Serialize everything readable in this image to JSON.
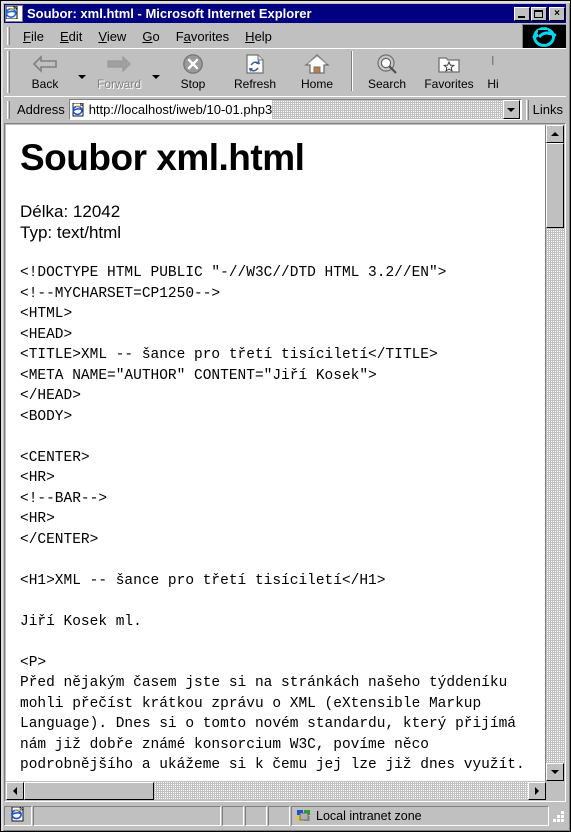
{
  "window": {
    "title": "Soubor: xml.html - Microsoft Internet Explorer",
    "icon": "ie-document-icon",
    "minimize_label": "",
    "maximize_label": "",
    "close_label": "×",
    "titlebar_color": "#000080",
    "face_color": "#c0c0c0"
  },
  "menu": {
    "items": [
      {
        "label": "File",
        "accel": "F"
      },
      {
        "label": "Edit",
        "accel": "E"
      },
      {
        "label": "View",
        "accel": "V"
      },
      {
        "label": "Go",
        "accel": "G"
      },
      {
        "label": "Favorites",
        "accel": "a"
      },
      {
        "label": "Help",
        "accel": "H"
      }
    ],
    "brand_icon": "ie-logo-icon"
  },
  "toolbar": {
    "buttons": [
      {
        "label": "Back",
        "icon": "back-arrow-icon",
        "disabled": false,
        "has_dropdown": true
      },
      {
        "label": "Forward",
        "icon": "forward-arrow-icon",
        "disabled": true,
        "has_dropdown": true
      },
      {
        "label": "Stop",
        "icon": "stop-icon",
        "disabled": false,
        "has_dropdown": false
      },
      {
        "label": "Refresh",
        "icon": "refresh-icon",
        "disabled": false,
        "has_dropdown": false
      },
      {
        "label": "Home",
        "icon": "home-icon",
        "disabled": false,
        "has_dropdown": false
      },
      {
        "label": "Search",
        "icon": "search-icon",
        "disabled": false,
        "has_dropdown": false
      },
      {
        "label": "Favorites",
        "icon": "favorites-icon",
        "disabled": false,
        "has_dropdown": false
      },
      {
        "label": "Hi",
        "icon": "history-icon",
        "disabled": false,
        "has_dropdown": false
      }
    ]
  },
  "address": {
    "label": "Address",
    "value": "http://localhost/iweb/10-01.php3",
    "placeholder": "",
    "icon": "ie-document-icon",
    "dropdown_icon": "chevron-down-icon",
    "links_label": "Links"
  },
  "page": {
    "heading": "Soubor xml.html",
    "meta": [
      "Délka: 12042",
      "Typ: text/html"
    ],
    "source": "<!DOCTYPE HTML PUBLIC \"-//W3C//DTD HTML 3.2//EN\">\n<!--MYCHARSET=CP1250-->\n<HTML>\n<HEAD>\n<TITLE>XML -- šance pro třetí tisíciletí</TITLE>\n<META NAME=\"AUTHOR\" CONTENT=\"Jiří Kosek\">\n</HEAD>\n<BODY>\n\n<CENTER>\n<HR>\n<!--BAR-->\n<HR>\n</CENTER>\n\n<H1>XML -- šance pro třetí tisíciletí</H1>\n\nJiří Kosek ml.\n\n<P>\nPřed nějakým časem jste si na stránkách našeho týddeníku\nmohli přečíst krátkou zprávu o XML (eXtensible Markup\nLanguage). Dnes si o tomto novém standardu, který přijímá\nnám již dobře známé konsorcium W3C, povíme něco\npodrobnějšího a ukážeme si k čemu jej lze již dnes využít."
  },
  "scrollbars": {
    "vertical": {
      "up_icon": "scroll-up-arrow-icon",
      "down_icon": "scroll-down-arrow-icon",
      "thumb_position_percent": 0
    },
    "horizontal": {
      "left_icon": "scroll-left-arrow-icon",
      "right_icon": "scroll-right-arrow-icon",
      "thumb_position_percent": 0
    }
  },
  "statusbar": {
    "doc_icon": "ie-document-icon",
    "message": "",
    "zone_icon": "intranet-zone-icon",
    "zone_text": "Local intranet zone"
  }
}
